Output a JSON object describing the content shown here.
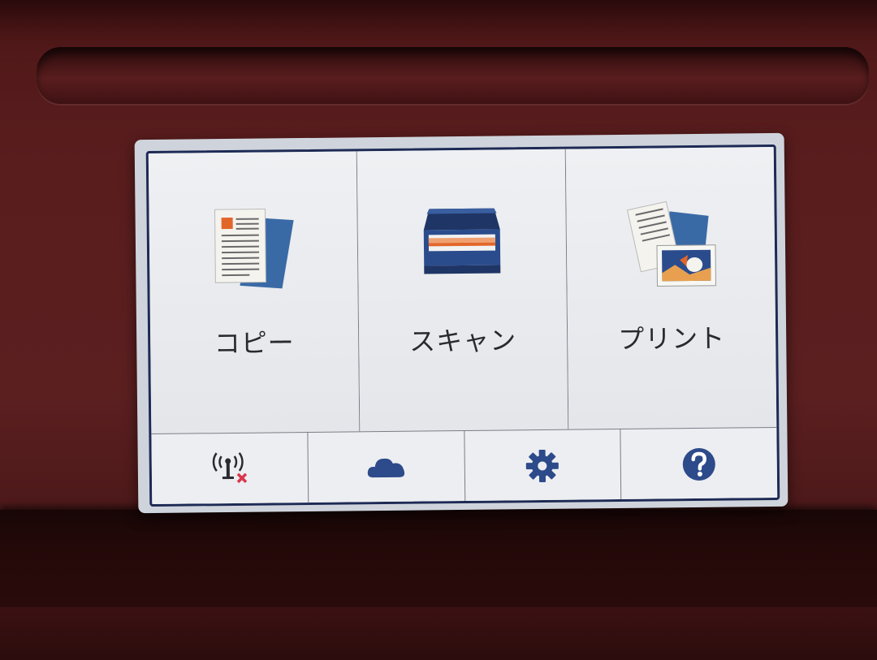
{
  "main_menu": {
    "tiles": [
      {
        "label": "コピー",
        "icon": "copy-document-icon"
      },
      {
        "label": "スキャン",
        "icon": "scanner-icon"
      },
      {
        "label": "プリント",
        "icon": "print-photo-icon"
      }
    ]
  },
  "bottom_bar": {
    "buttons": [
      {
        "icon": "wireless-disconnected-icon"
      },
      {
        "icon": "cloud-icon"
      },
      {
        "icon": "gear-icon"
      },
      {
        "icon": "help-icon"
      }
    ]
  },
  "colors": {
    "housing": "#5a1d1e",
    "screen_border": "#1d2a55",
    "icon_blue": "#2d4a8a",
    "accent_orange": "#e2662a",
    "alert_red": "#d9364a"
  }
}
